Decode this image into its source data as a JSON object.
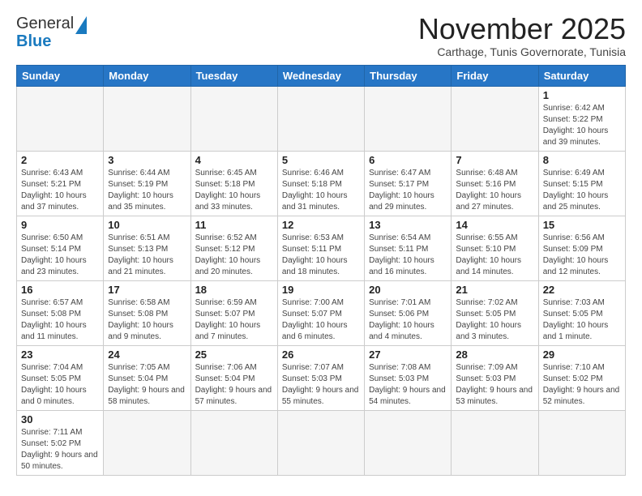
{
  "header": {
    "logo_line1": "General",
    "logo_line2": "Blue",
    "month_title": "November 2025",
    "subtitle": "Carthage, Tunis Governorate, Tunisia"
  },
  "weekdays": [
    "Sunday",
    "Monday",
    "Tuesday",
    "Wednesday",
    "Thursday",
    "Friday",
    "Saturday"
  ],
  "days": [
    {
      "num": "",
      "info": ""
    },
    {
      "num": "",
      "info": ""
    },
    {
      "num": "",
      "info": ""
    },
    {
      "num": "",
      "info": ""
    },
    {
      "num": "",
      "info": ""
    },
    {
      "num": "",
      "info": ""
    },
    {
      "num": "1",
      "info": "Sunrise: 6:42 AM\nSunset: 5:22 PM\nDaylight: 10 hours and 39 minutes."
    },
    {
      "num": "2",
      "info": "Sunrise: 6:43 AM\nSunset: 5:21 PM\nDaylight: 10 hours and 37 minutes."
    },
    {
      "num": "3",
      "info": "Sunrise: 6:44 AM\nSunset: 5:19 PM\nDaylight: 10 hours and 35 minutes."
    },
    {
      "num": "4",
      "info": "Sunrise: 6:45 AM\nSunset: 5:18 PM\nDaylight: 10 hours and 33 minutes."
    },
    {
      "num": "5",
      "info": "Sunrise: 6:46 AM\nSunset: 5:18 PM\nDaylight: 10 hours and 31 minutes."
    },
    {
      "num": "6",
      "info": "Sunrise: 6:47 AM\nSunset: 5:17 PM\nDaylight: 10 hours and 29 minutes."
    },
    {
      "num": "7",
      "info": "Sunrise: 6:48 AM\nSunset: 5:16 PM\nDaylight: 10 hours and 27 minutes."
    },
    {
      "num": "8",
      "info": "Sunrise: 6:49 AM\nSunset: 5:15 PM\nDaylight: 10 hours and 25 minutes."
    },
    {
      "num": "9",
      "info": "Sunrise: 6:50 AM\nSunset: 5:14 PM\nDaylight: 10 hours and 23 minutes."
    },
    {
      "num": "10",
      "info": "Sunrise: 6:51 AM\nSunset: 5:13 PM\nDaylight: 10 hours and 21 minutes."
    },
    {
      "num": "11",
      "info": "Sunrise: 6:52 AM\nSunset: 5:12 PM\nDaylight: 10 hours and 20 minutes."
    },
    {
      "num": "12",
      "info": "Sunrise: 6:53 AM\nSunset: 5:11 PM\nDaylight: 10 hours and 18 minutes."
    },
    {
      "num": "13",
      "info": "Sunrise: 6:54 AM\nSunset: 5:11 PM\nDaylight: 10 hours and 16 minutes."
    },
    {
      "num": "14",
      "info": "Sunrise: 6:55 AM\nSunset: 5:10 PM\nDaylight: 10 hours and 14 minutes."
    },
    {
      "num": "15",
      "info": "Sunrise: 6:56 AM\nSunset: 5:09 PM\nDaylight: 10 hours and 12 minutes."
    },
    {
      "num": "16",
      "info": "Sunrise: 6:57 AM\nSunset: 5:08 PM\nDaylight: 10 hours and 11 minutes."
    },
    {
      "num": "17",
      "info": "Sunrise: 6:58 AM\nSunset: 5:08 PM\nDaylight: 10 hours and 9 minutes."
    },
    {
      "num": "18",
      "info": "Sunrise: 6:59 AM\nSunset: 5:07 PM\nDaylight: 10 hours and 7 minutes."
    },
    {
      "num": "19",
      "info": "Sunrise: 7:00 AM\nSunset: 5:07 PM\nDaylight: 10 hours and 6 minutes."
    },
    {
      "num": "20",
      "info": "Sunrise: 7:01 AM\nSunset: 5:06 PM\nDaylight: 10 hours and 4 minutes."
    },
    {
      "num": "21",
      "info": "Sunrise: 7:02 AM\nSunset: 5:05 PM\nDaylight: 10 hours and 3 minutes."
    },
    {
      "num": "22",
      "info": "Sunrise: 7:03 AM\nSunset: 5:05 PM\nDaylight: 10 hours and 1 minute."
    },
    {
      "num": "23",
      "info": "Sunrise: 7:04 AM\nSunset: 5:05 PM\nDaylight: 10 hours and 0 minutes."
    },
    {
      "num": "24",
      "info": "Sunrise: 7:05 AM\nSunset: 5:04 PM\nDaylight: 9 hours and 58 minutes."
    },
    {
      "num": "25",
      "info": "Sunrise: 7:06 AM\nSunset: 5:04 PM\nDaylight: 9 hours and 57 minutes."
    },
    {
      "num": "26",
      "info": "Sunrise: 7:07 AM\nSunset: 5:03 PM\nDaylight: 9 hours and 55 minutes."
    },
    {
      "num": "27",
      "info": "Sunrise: 7:08 AM\nSunset: 5:03 PM\nDaylight: 9 hours and 54 minutes."
    },
    {
      "num": "28",
      "info": "Sunrise: 7:09 AM\nSunset: 5:03 PM\nDaylight: 9 hours and 53 minutes."
    },
    {
      "num": "29",
      "info": "Sunrise: 7:10 AM\nSunset: 5:02 PM\nDaylight: 9 hours and 52 minutes."
    },
    {
      "num": "30",
      "info": "Sunrise: 7:11 AM\nSunset: 5:02 PM\nDaylight: 9 hours and 50 minutes."
    },
    {
      "num": "",
      "info": ""
    },
    {
      "num": "",
      "info": ""
    },
    {
      "num": "",
      "info": ""
    },
    {
      "num": "",
      "info": ""
    },
    {
      "num": "",
      "info": ""
    },
    {
      "num": "",
      "info": ""
    }
  ]
}
